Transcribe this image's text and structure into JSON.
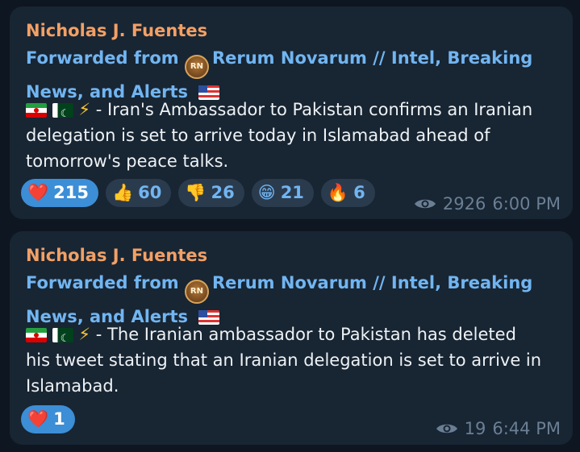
{
  "messages": [
    {
      "author": "Nicholas J. Fuentes",
      "forward_prefix": "Forwarded from",
      "channel_avatar_initials": "RN",
      "channel_line1": "Rerum Novarum // Intel, Breaking",
      "channel_line2": "News, and Alerts",
      "text_line1": " - Iran's Ambassador to Pakistan confirms an Iranian",
      "text_line2": "delegation is set to arrive today in Islamabad ahead of",
      "text_line3": "tomorrow's peace talks.",
      "reactions": [
        {
          "emoji": "❤️",
          "count": "215",
          "chosen": true
        },
        {
          "emoji": "👍",
          "count": "60"
        },
        {
          "emoji": "👎",
          "count": "26"
        },
        {
          "emoji": "😁",
          "count": "21"
        },
        {
          "emoji": "🔥",
          "count": "6"
        }
      ],
      "views": "2926",
      "time": "6:00 PM"
    },
    {
      "author": "Nicholas J. Fuentes",
      "forward_prefix": "Forwarded from",
      "channel_avatar_initials": "RN",
      "channel_line1": "Rerum Novarum // Intel, Breaking",
      "channel_line2": "News, and Alerts",
      "text_line1": " - The Iranian ambassador to Pakistan has deleted",
      "text_line2": "his tweet stating that an Iranian delegation is set to arrive in",
      "text_line3": "Islamabad.",
      "reactions": [
        {
          "emoji": "❤️",
          "count": "1",
          "chosen": true
        }
      ],
      "views": "19",
      "time": "6:44 PM"
    }
  ],
  "colors": {
    "background": "#0e1621",
    "bubble": "#182533",
    "author": "#f2a065",
    "link": "#71b5f1",
    "reaction_chosen": "#3c8ed6",
    "reaction": "#2b3b4e",
    "meta": "#6b7f94"
  },
  "icons": [
    "heart-icon",
    "thumbs-up-icon",
    "thumbs-down-icon",
    "grin-icon",
    "fire-icon",
    "eye-icon",
    "iran-flag-icon",
    "pakistan-flag-icon",
    "lightning-icon",
    "us-flag-icon"
  ]
}
